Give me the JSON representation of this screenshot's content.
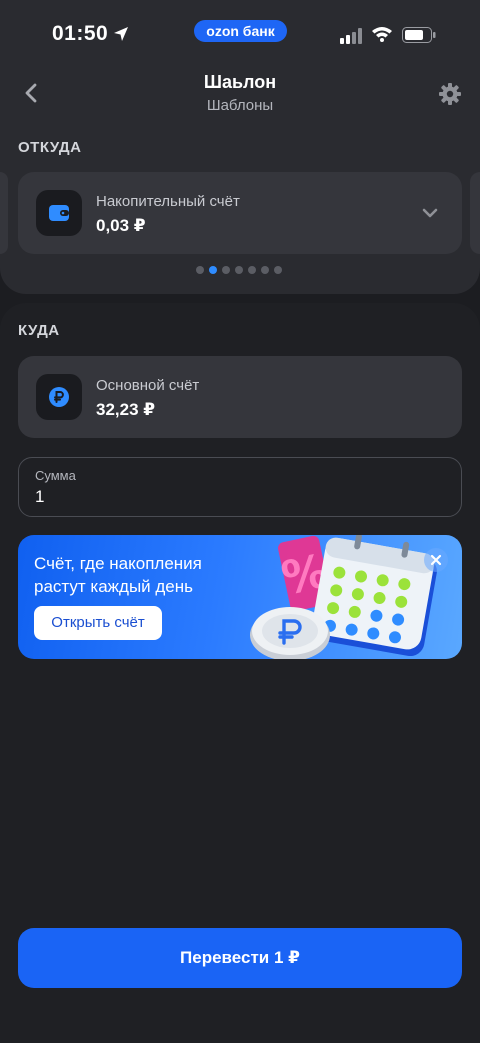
{
  "status_bar": {
    "time": "01:50",
    "brand": "ozon банк"
  },
  "header": {
    "title": "Шаьлон",
    "subtitle": "Шаблоны"
  },
  "from": {
    "label": "ОТКУДА",
    "account_name": "Накопительный счёт",
    "balance": "0,03 ₽",
    "icon": "wallet-icon",
    "carousel_total": 7,
    "carousel_active": 1
  },
  "to": {
    "label": "КУДА",
    "account_name": "Основной счёт",
    "balance": "32,23 ₽",
    "icon": "ruble-icon"
  },
  "amount": {
    "label": "Сумма",
    "value": "1"
  },
  "promo": {
    "line1": "Счёт, где накопления",
    "line2": "растут каждый день",
    "button": "Открыть счёт"
  },
  "transfer_button": "Перевести 1 ₽",
  "colors": {
    "background": "#1c1d21",
    "card": "#35363c",
    "accent": "#1a64f5",
    "dot_active": "#2f8cff"
  }
}
